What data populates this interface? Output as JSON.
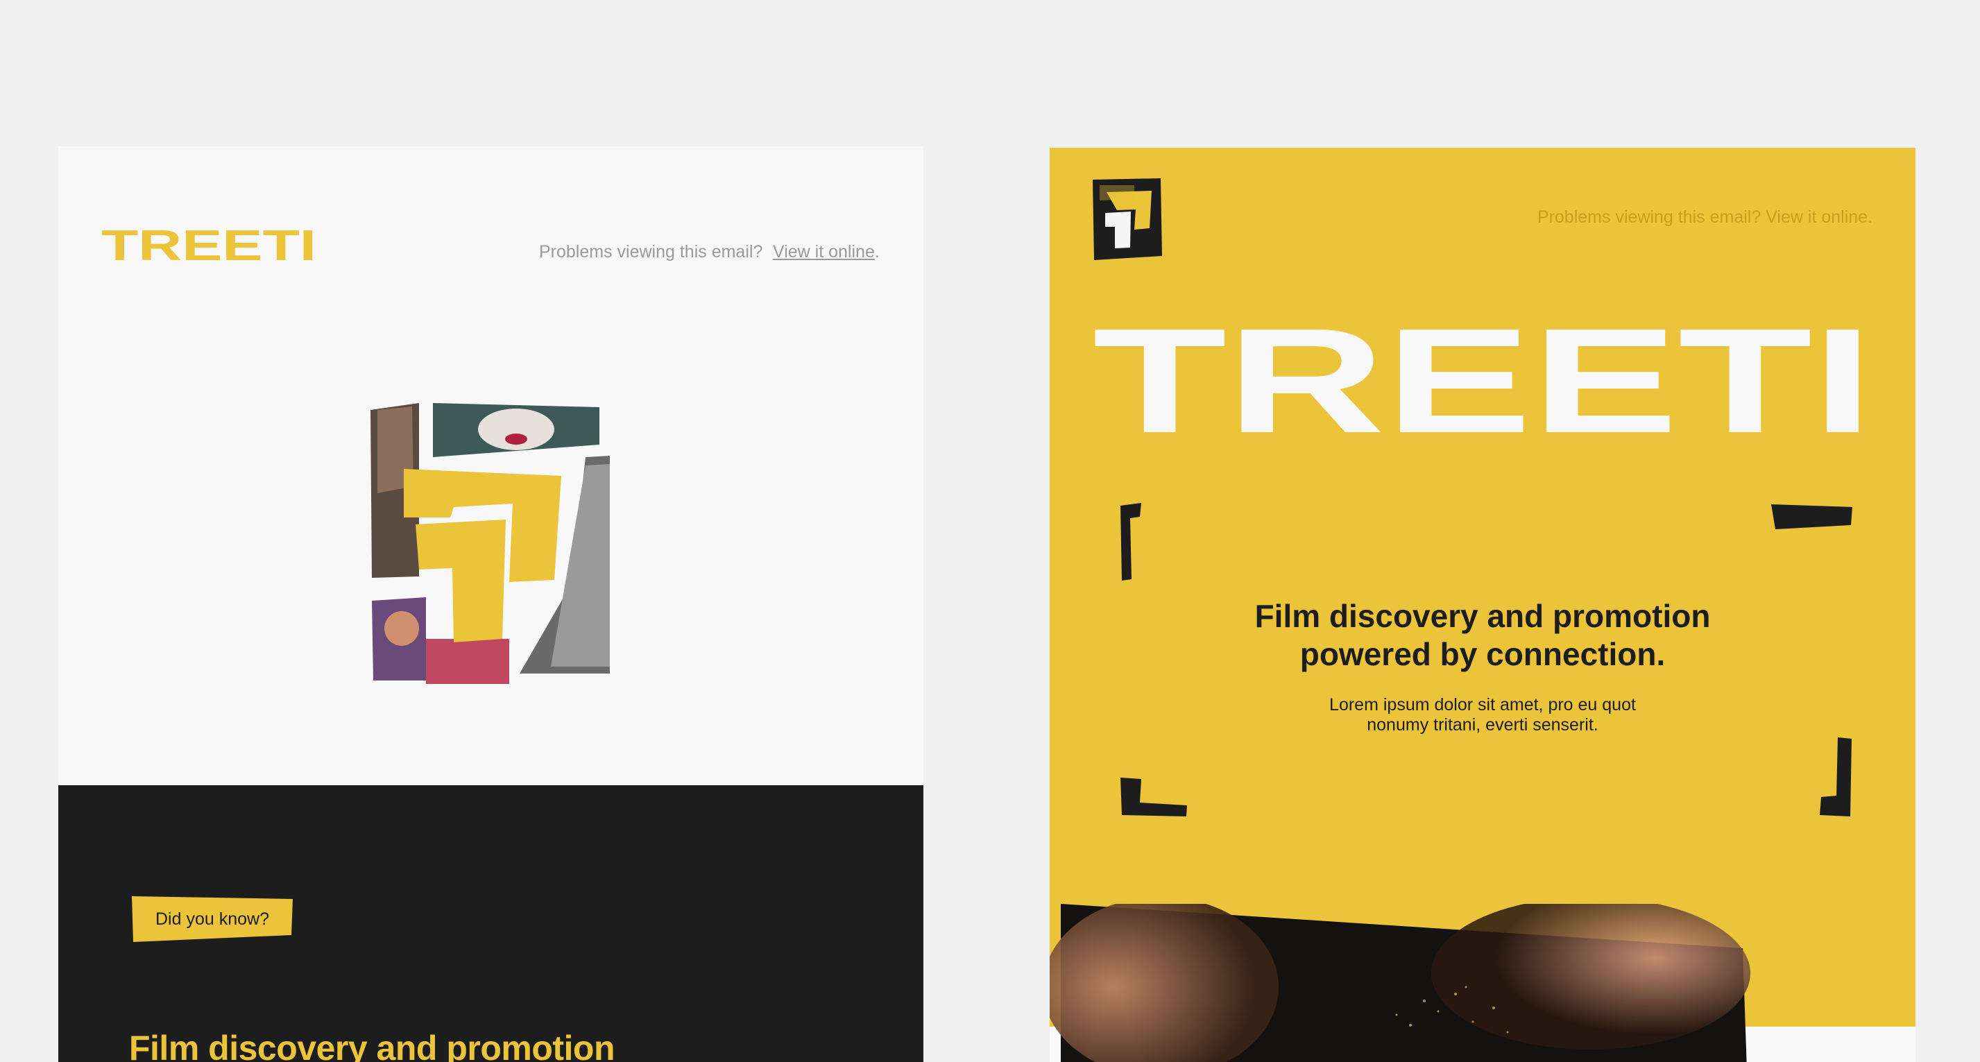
{
  "left_email": {
    "brand": "TREETI",
    "header": {
      "problems_text": "Problems viewing this email?",
      "view_online_link": "View it online",
      "trailing_dot": "."
    },
    "dark_section": {
      "badge_label": "Did you know?",
      "headline": "Film discovery and promotion"
    }
  },
  "right_email": {
    "brand": "TREETI",
    "header": {
      "problems_text": "Problems viewing this email? View it online."
    },
    "hero": {
      "headline_line1": "Film discovery and promotion",
      "headline_line2": "powered by connection.",
      "sub_line1": "Lorem ipsum dolor sit amet, pro eu quot",
      "sub_line2": "nonumy tritani, everti senserit."
    }
  },
  "colors": {
    "brand_yellow": "#ecc43a",
    "dark": "#1d1d1d",
    "light_bg": "#f8f8f8",
    "page_bg": "#f0f0f0"
  }
}
